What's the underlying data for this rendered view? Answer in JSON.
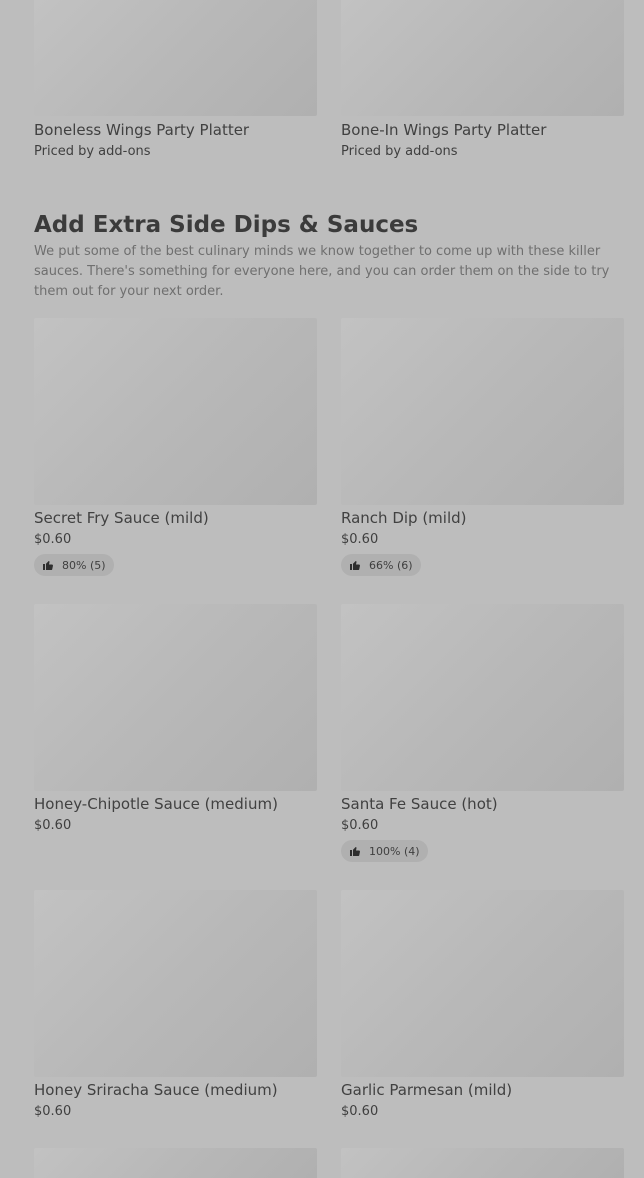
{
  "top_items": [
    {
      "name": "Boneless Wings Party Platter",
      "price": "Priced by add-ons"
    },
    {
      "name": "Bone-In Wings Party Platter",
      "price": "Priced by add-ons"
    }
  ],
  "section": {
    "title": "Add Extra Side Dips & Sauces",
    "description": "We put some of the best culinary minds we know together to come up with these killer sauces. There's something for everyone here, and you can order them on the side to try them out for your next order."
  },
  "items": [
    {
      "name": "Secret Fry Sauce (mild)",
      "price": "$0.60",
      "rating": "80% (5)"
    },
    {
      "name": "Ranch Dip (mild)",
      "price": "$0.60",
      "rating": "66% (6)"
    },
    {
      "name": "Honey-Chipotle Sauce (medium)",
      "price": "$0.60",
      "rating": null
    },
    {
      "name": "Santa Fe Sauce (hot)",
      "price": "$0.60",
      "rating": "100% (4)"
    },
    {
      "name": "Honey Sriracha Sauce (medium)",
      "price": "$0.60",
      "rating": null
    },
    {
      "name": "Garlic Parmesan (mild)",
      "price": "$0.60",
      "rating": null
    }
  ],
  "icons": {
    "rating": "thumbs-up-icon"
  }
}
